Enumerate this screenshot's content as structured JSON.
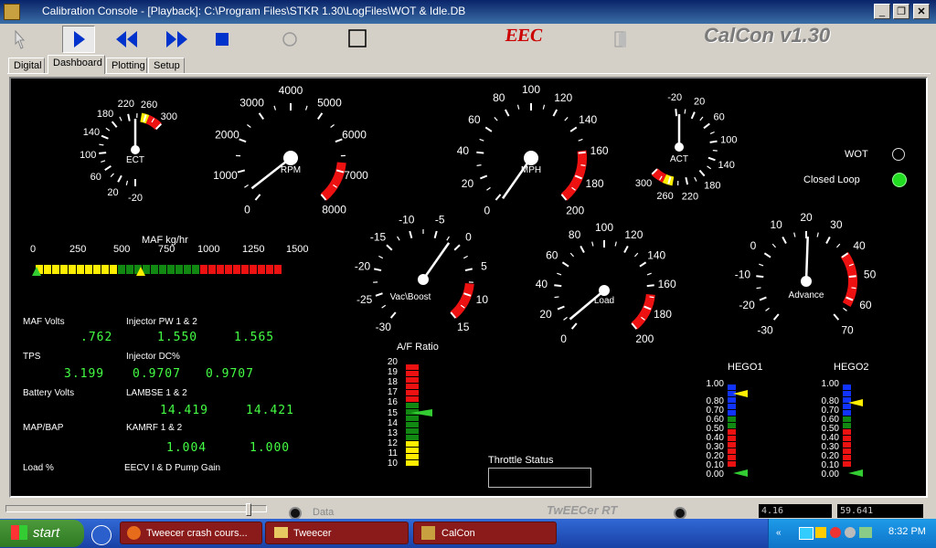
{
  "window": {
    "title": "Calibration Console - [Playback]: C:\\Program Files\\STKR 1.30\\LogFiles\\WOT & Idle.DB"
  },
  "toolbar": {
    "eec_logo": "EEC",
    "brand": "CalCon v1.30"
  },
  "tabs": [
    "Digital",
    "Dashboard",
    "Plotting",
    "Setup"
  ],
  "gauges": {
    "ect": {
      "label": "ECT",
      "ticks": [
        "-20",
        "20",
        "60",
        "100",
        "140",
        "180",
        "220",
        "260",
        "300"
      ]
    },
    "rpm": {
      "label": "RPM",
      "ticks": [
        "0",
        "1000",
        "2000",
        "3000",
        "4000",
        "5000",
        "6000",
        "7000",
        "8000"
      ]
    },
    "mph": {
      "label": "MPH",
      "ticks": [
        "0",
        "20",
        "40",
        "60",
        "80",
        "100",
        "120",
        "140",
        "160",
        "180",
        "200"
      ]
    },
    "act": {
      "label": "ACT",
      "ticks": [
        "-20",
        "20",
        "60",
        "100",
        "140",
        "180",
        "220",
        "260",
        "300"
      ]
    },
    "vac": {
      "label": "Vac\\Boost",
      "ticks": [
        "-30",
        "-25",
        "-20",
        "-15",
        "-10",
        "-5",
        "0",
        "5",
        "10",
        "15"
      ]
    },
    "load": {
      "label": "Load",
      "ticks": [
        "0",
        "20",
        "40",
        "60",
        "80",
        "100",
        "120",
        "140",
        "160",
        "180",
        "200"
      ]
    },
    "advance": {
      "label": "Advance",
      "ticks": [
        "-30",
        "-20",
        "-10",
        "0",
        "10",
        "20",
        "30",
        "40",
        "50",
        "60",
        "70"
      ]
    }
  },
  "indicators": {
    "wot_label": "WOT",
    "closed_loop_label": "Closed Loop",
    "wot_on": false,
    "closed_loop_on": true
  },
  "maf": {
    "label": "MAF kg/hr",
    "scale": [
      "0",
      "250",
      "500",
      "750",
      "1000",
      "1250",
      "1500"
    ]
  },
  "readouts": {
    "maf_volts_label": "MAF Volts",
    "maf_volts": ".762",
    "injector_pw_label": "Injector PW 1 & 2",
    "injector_pw_1": "1.550",
    "injector_pw_2": "1.565",
    "tps_label": "TPS",
    "tps": "3.199",
    "injector_dc_label": "Injector DC%",
    "injector_dc_1": "0.9707",
    "injector_dc_2": "0.9707",
    "battery_label": "Battery Volts",
    "lambse_label": "LAMBSE 1 & 2",
    "lambse_1": "14.419",
    "lambse_2": "14.421",
    "mapbap_label": "MAP/BAP",
    "kamrf_label": "KAMRF 1 & 2",
    "kamrf_1": "1.004",
    "kamrf_2": "1.000",
    "load_pct_label": "Load %",
    "eecv_label": "EECV I & D Pump Gain"
  },
  "af_ratio": {
    "label": "A/F Ratio",
    "scale": [
      "20",
      "19",
      "18",
      "17",
      "16",
      "15",
      "14",
      "13",
      "12",
      "11",
      "10"
    ]
  },
  "throttle": {
    "label": "Throttle Status"
  },
  "hego": {
    "hego1_label": "HEGO1",
    "hego2_label": "HEGO2",
    "scale": [
      "1.00",
      "0.80",
      "0.70",
      "0.60",
      "0.50",
      "0.40",
      "0.30",
      "0.20",
      "0.10",
      "0.00"
    ]
  },
  "statusbar": {
    "data_label": "Data",
    "logo": "TwEECer RT",
    "readout1": "4.16",
    "readout2": "59.641"
  },
  "taskbar": {
    "start": "start",
    "items": [
      "Tweecer crash cours...",
      "Tweecer",
      "CalCon"
    ],
    "clock": "8:32 PM"
  }
}
